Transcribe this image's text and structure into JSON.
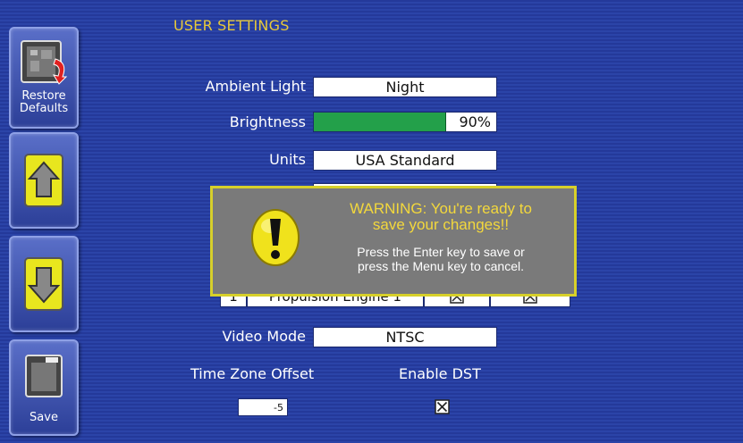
{
  "header": {
    "title": "USER SETTINGS"
  },
  "sidebar": {
    "restore_label_1": "Restore",
    "restore_label_2": "Defaults",
    "save_label": "Save"
  },
  "settings": {
    "ambient_light": {
      "label": "Ambient Light",
      "value": "Night"
    },
    "brightness": {
      "label": "Brightness",
      "value": "90%",
      "level": 0.72
    },
    "units": {
      "label": "Units",
      "value": "USA Standard"
    },
    "hidden_row": {
      "col1": "1",
      "col2": "Propulsion Engine 1"
    },
    "video_mode": {
      "label": "Video Mode",
      "value": "NTSC"
    },
    "time_zone": {
      "label": "Time Zone Offset",
      "value": "-5"
    },
    "dst": {
      "label": "Enable DST",
      "checked": true
    }
  },
  "dialog": {
    "title_line1": "WARNING: You're ready to",
    "title_line2": "save your changes!!",
    "body_line1": "Press the Enter key to save or",
    "body_line2": "press the Menu key to cancel.",
    "icon": "warning-exclamation-icon"
  },
  "colors": {
    "accent": "#e7c93a",
    "background": "#2b44a8",
    "bar": "#23a04a",
    "dialog": "#7a7a7a",
    "dialog_border": "#d7d02a"
  }
}
